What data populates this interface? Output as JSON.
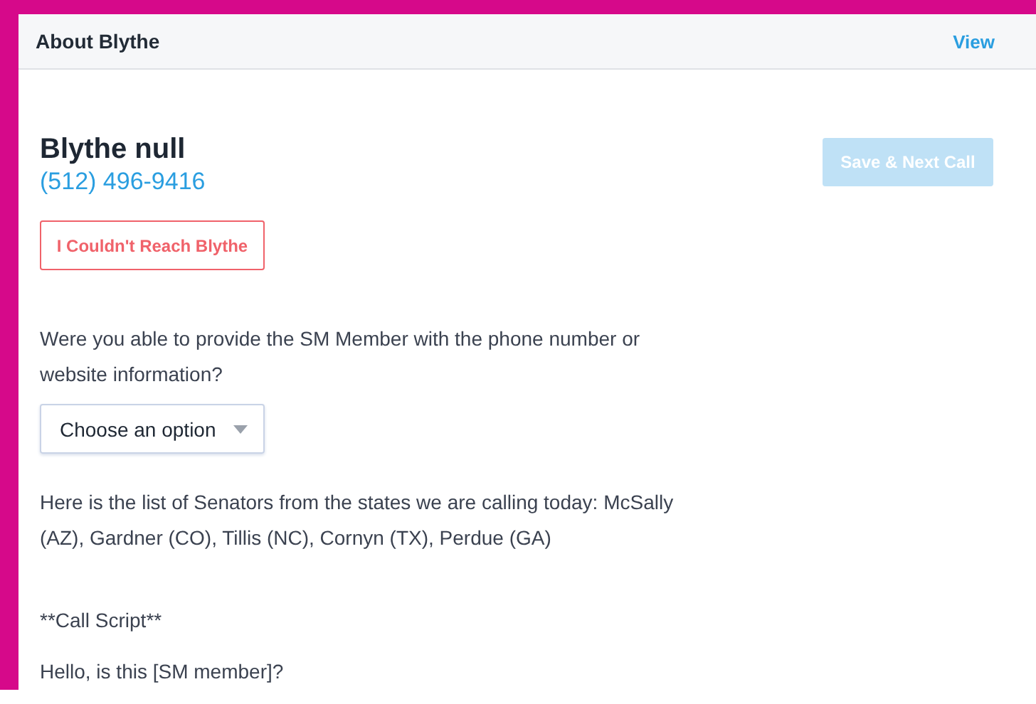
{
  "header": {
    "title": "About Blythe",
    "link": "View"
  },
  "contact": {
    "name": "Blythe null",
    "phone": "(512) 496-9416"
  },
  "save_button": {
    "label": "Save & Next Call",
    "disabled": true
  },
  "unreachable_button": {
    "label": "I Couldn't Reach Blythe"
  },
  "question": {
    "text": "Were you able to provide the SM Member with the phone number or website information?",
    "dropdown": {
      "placeholder": "Choose an option"
    }
  },
  "paragraphs": [
    "Here is the list of Senators from the states we are calling today: McSally (AZ), Gardner (CO), Tillis (NC), Cornyn (TX), Perdue (GA)",
    "**Call Script**",
    "Hello, is this [SM member]?"
  ]
}
